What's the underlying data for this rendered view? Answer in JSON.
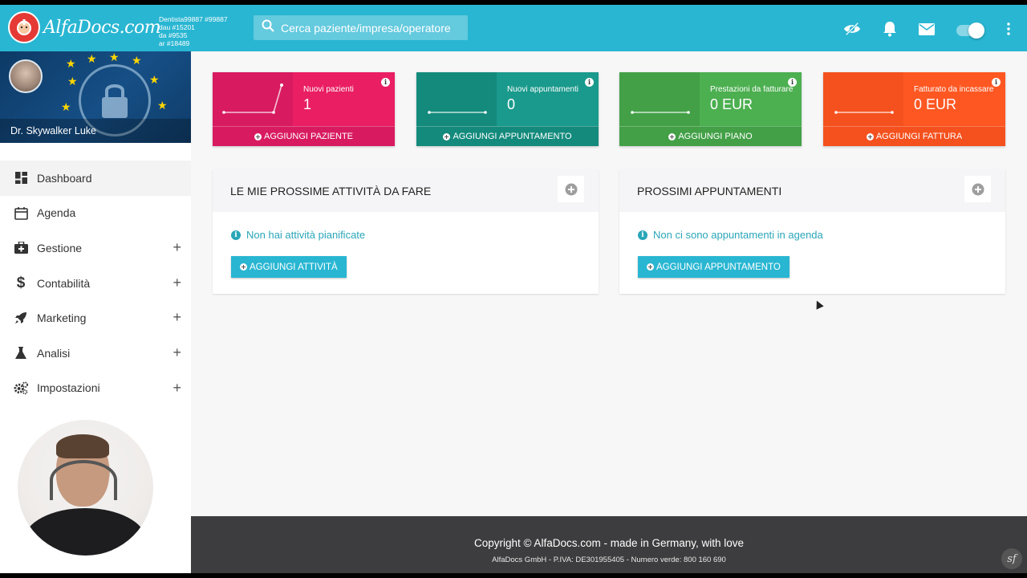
{
  "header": {
    "logo_text": "AlfaDocs.com",
    "ids": [
      "Dentista99887 #99887",
      "dau #15201",
      "da #9535",
      "ar #18489"
    ],
    "search_placeholder": "Cerca paziente/impresa/operatore",
    "icons": [
      "eye-off-icon",
      "bell-icon",
      "mail-icon",
      "toggle-switch",
      "more-vert-icon"
    ]
  },
  "sidebar": {
    "user_name": "Dr. Skywalker Luke",
    "items": [
      {
        "label": "Dashboard",
        "icon": "dashboard-icon",
        "active": true,
        "expandable": false
      },
      {
        "label": "Agenda",
        "icon": "calendar-icon",
        "active": false,
        "expandable": false
      },
      {
        "label": "Gestione",
        "icon": "briefcase-medical-icon",
        "active": false,
        "expandable": true
      },
      {
        "label": "Contabilità",
        "icon": "dollar-icon",
        "active": false,
        "expandable": true
      },
      {
        "label": "Marketing",
        "icon": "rocket-icon",
        "active": false,
        "expandable": true
      },
      {
        "label": "Analisi",
        "icon": "flask-icon",
        "active": false,
        "expandable": true
      },
      {
        "label": "Impostazioni",
        "icon": "gears-icon",
        "active": false,
        "expandable": true
      }
    ]
  },
  "stats": [
    {
      "label": "Nuovi pazienti",
      "value": "1",
      "button": "AGGIUNGI PAZIENTE",
      "color": "#e91e63",
      "color_dark": "#d81b60"
    },
    {
      "label": "Nuovi appuntamenti",
      "value": "0",
      "button": "AGGIUNGI APPUNTAMENTO",
      "color": "#1a9a8c",
      "color_dark": "#148a7c"
    },
    {
      "label": "Prestazioni da fatturare",
      "value": "0 EUR",
      "button": "AGGIUNGI PIANO",
      "color": "#4caf50",
      "color_dark": "#43a047"
    },
    {
      "label": "Fatturato da incassare",
      "value": "0 EUR",
      "button": "AGGIUNGI FATTURA",
      "color": "#ff5722",
      "color_dark": "#f4511e"
    }
  ],
  "panels": [
    {
      "title": "LE MIE PROSSIME ATTIVITÀ DA FARE",
      "message": "Non hai attività pianificate",
      "button": "AGGIUNGI ATTIVITÀ"
    },
    {
      "title": "PROSSIMI APPUNTAMENTI",
      "message": "Non ci sono appuntamenti in agenda",
      "button": "AGGIUNGI APPUNTAMENTO"
    }
  ],
  "footer": {
    "copyright": "Copyright © AlfaDocs.com - made in Germany, with love",
    "company": "AlfaDocs GmbH - P.IVA: DE301955405 - Numero verde: 800 160 690"
  }
}
